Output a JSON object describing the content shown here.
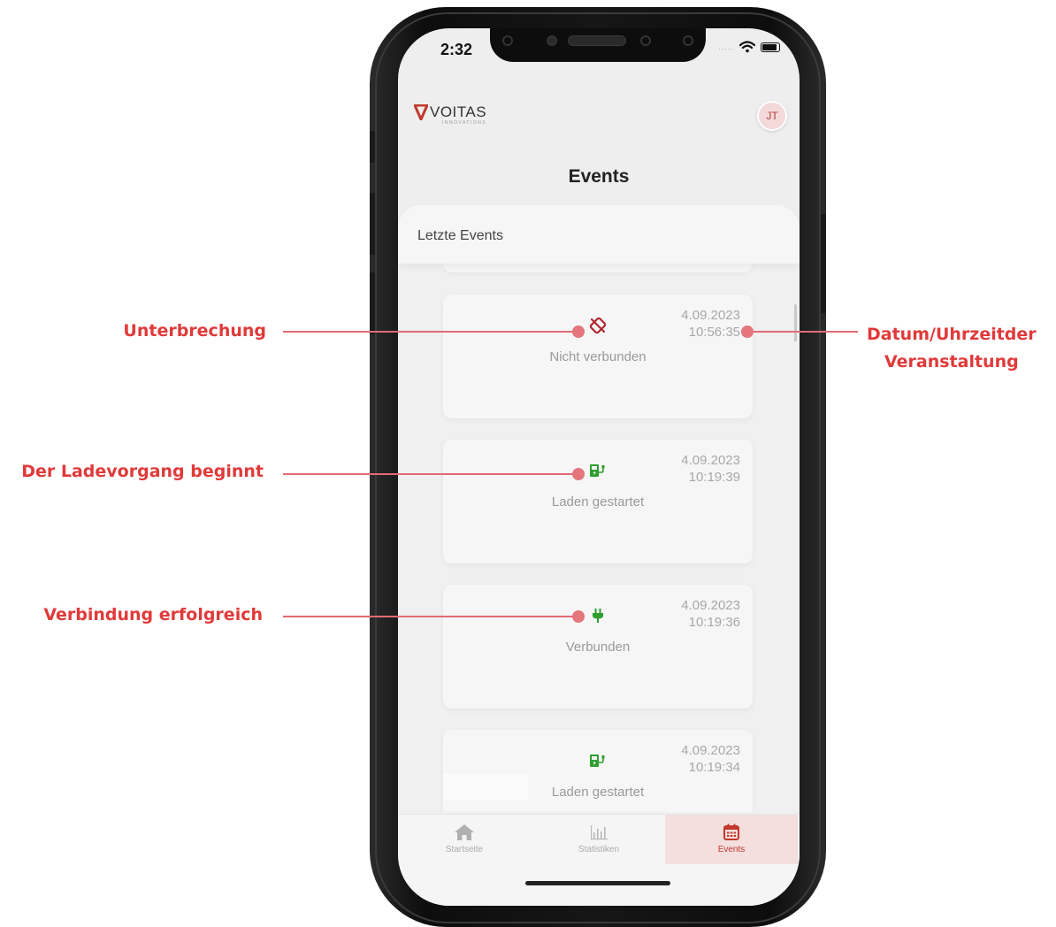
{
  "status_bar": {
    "time": "2:32",
    "indicator_dots": "....."
  },
  "header": {
    "logo": {
      "mark": "V",
      "name": "VOITAS",
      "tagline": "INNOVATIONS"
    },
    "avatar_initials": "JT",
    "page_title": "Events"
  },
  "events_panel": {
    "title": "Letzte Events",
    "events": [
      {
        "icon": "unlink-icon",
        "icon_color": "#b3262e",
        "label": "Nicht verbunden",
        "date": "4.09.2023",
        "time": "10:56:35"
      },
      {
        "icon": "charging-station-icon",
        "icon_color": "#2e9e2e",
        "label": "Laden gestartet",
        "date": "4.09.2023",
        "time": "10:19:39"
      },
      {
        "icon": "plug-icon",
        "icon_color": "#2e9e2e",
        "label": "Verbunden",
        "date": "4.09.2023",
        "time": "10:19:36"
      },
      {
        "icon": "charging-station-icon",
        "icon_color": "#2e9e2e",
        "label": "Laden gestartet",
        "date": "4.09.2023",
        "time": "10:19:34"
      }
    ]
  },
  "tab_bar": {
    "tabs": [
      {
        "label": "Startseite",
        "icon": "home-icon",
        "active": false
      },
      {
        "label": "Statistiken",
        "icon": "bar-chart-icon",
        "active": false
      },
      {
        "label": "Events",
        "icon": "calendar-icon",
        "active": true
      }
    ]
  },
  "annotations": {
    "unterbrechung": "Unterbrechung",
    "ladevorgang": "Der Ladevorgang beginnt",
    "verbindung": "Verbindung erfolgreich",
    "datum_line1": "Datum/Uhrzeitder",
    "datum_line2": "Veranstaltung"
  },
  "colors": {
    "accent": "#e03a3a",
    "brand_red": "#c0392b",
    "ok_green": "#2e9e2e"
  }
}
